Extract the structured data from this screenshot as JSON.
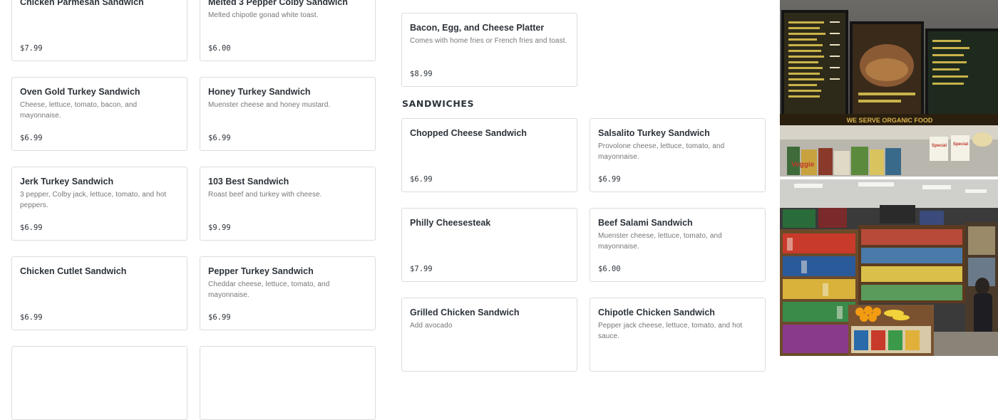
{
  "left_cards": [
    {
      "name": "Chicken Parmesan Sandwich",
      "desc": "",
      "price": "$7.99"
    },
    {
      "name": "Melted 3 Pepper Colby Sandwich",
      "desc": "Melted chipotle gonad white toast.",
      "price": "$6.00"
    },
    {
      "name": "Oven Gold Turkey Sandwich",
      "desc": "Cheese, lettuce, tomato, bacon, and mayonnaise.",
      "price": "$6.99"
    },
    {
      "name": "Honey Turkey Sandwich",
      "desc": "Muenster cheese and honey mustard.",
      "price": "$6.99"
    },
    {
      "name": "Jerk Turkey Sandwich",
      "desc": "3 pepper, Colby jack, lettuce, tomato, and hot peppers.",
      "price": "$6.99"
    },
    {
      "name": "103 Best Sandwich",
      "desc": "Roast beef and turkey with cheese.",
      "price": "$9.99"
    },
    {
      "name": "Chicken Cutlet Sandwich",
      "desc": "",
      "price": "$6.99"
    },
    {
      "name": "Pepper Turkey Sandwich",
      "desc": "Cheddar cheese, lettuce, tomato, and mayonnaise.",
      "price": "$6.99"
    }
  ],
  "platter_card": {
    "name": "Bacon, Egg, and Cheese Platter",
    "desc": "Comes with home fries or French fries and toast.",
    "price": "$8.99"
  },
  "sandwiches_section": {
    "title": "SANDWICHES",
    "cards": [
      {
        "name": "Chopped Cheese Sandwich",
        "desc": "",
        "price": "$6.99"
      },
      {
        "name": "Salsalito Turkey Sandwich",
        "desc": "Provolone cheese, lettuce, tomato, and mayonnaise.",
        "price": "$6.99"
      },
      {
        "name": "Philly Cheesesteak",
        "desc": "",
        "price": "$7.99"
      },
      {
        "name": "Beef Salami Sandwich",
        "desc": "Muenster cheese, lettuce, tomato, and mayonnaise.",
        "price": "$6.00"
      },
      {
        "name": "Grilled Chicken Sandwich",
        "desc": "Add avocado",
        "price": ""
      },
      {
        "name": "Chipotle Chicken Sandwich",
        "desc": "Pepper jack cheese, lettuce, tomato, and hot sauce.",
        "price": ""
      }
    ]
  },
  "photos": {
    "top": {
      "alt": "Menu boards above deli counter",
      "sign_text": "WE SERVE ORGANIC FOOD",
      "tags": [
        "Veggie",
        "Special",
        "Special"
      ]
    },
    "bottom": {
      "alt": "Store interior with shelves and fruit"
    }
  }
}
